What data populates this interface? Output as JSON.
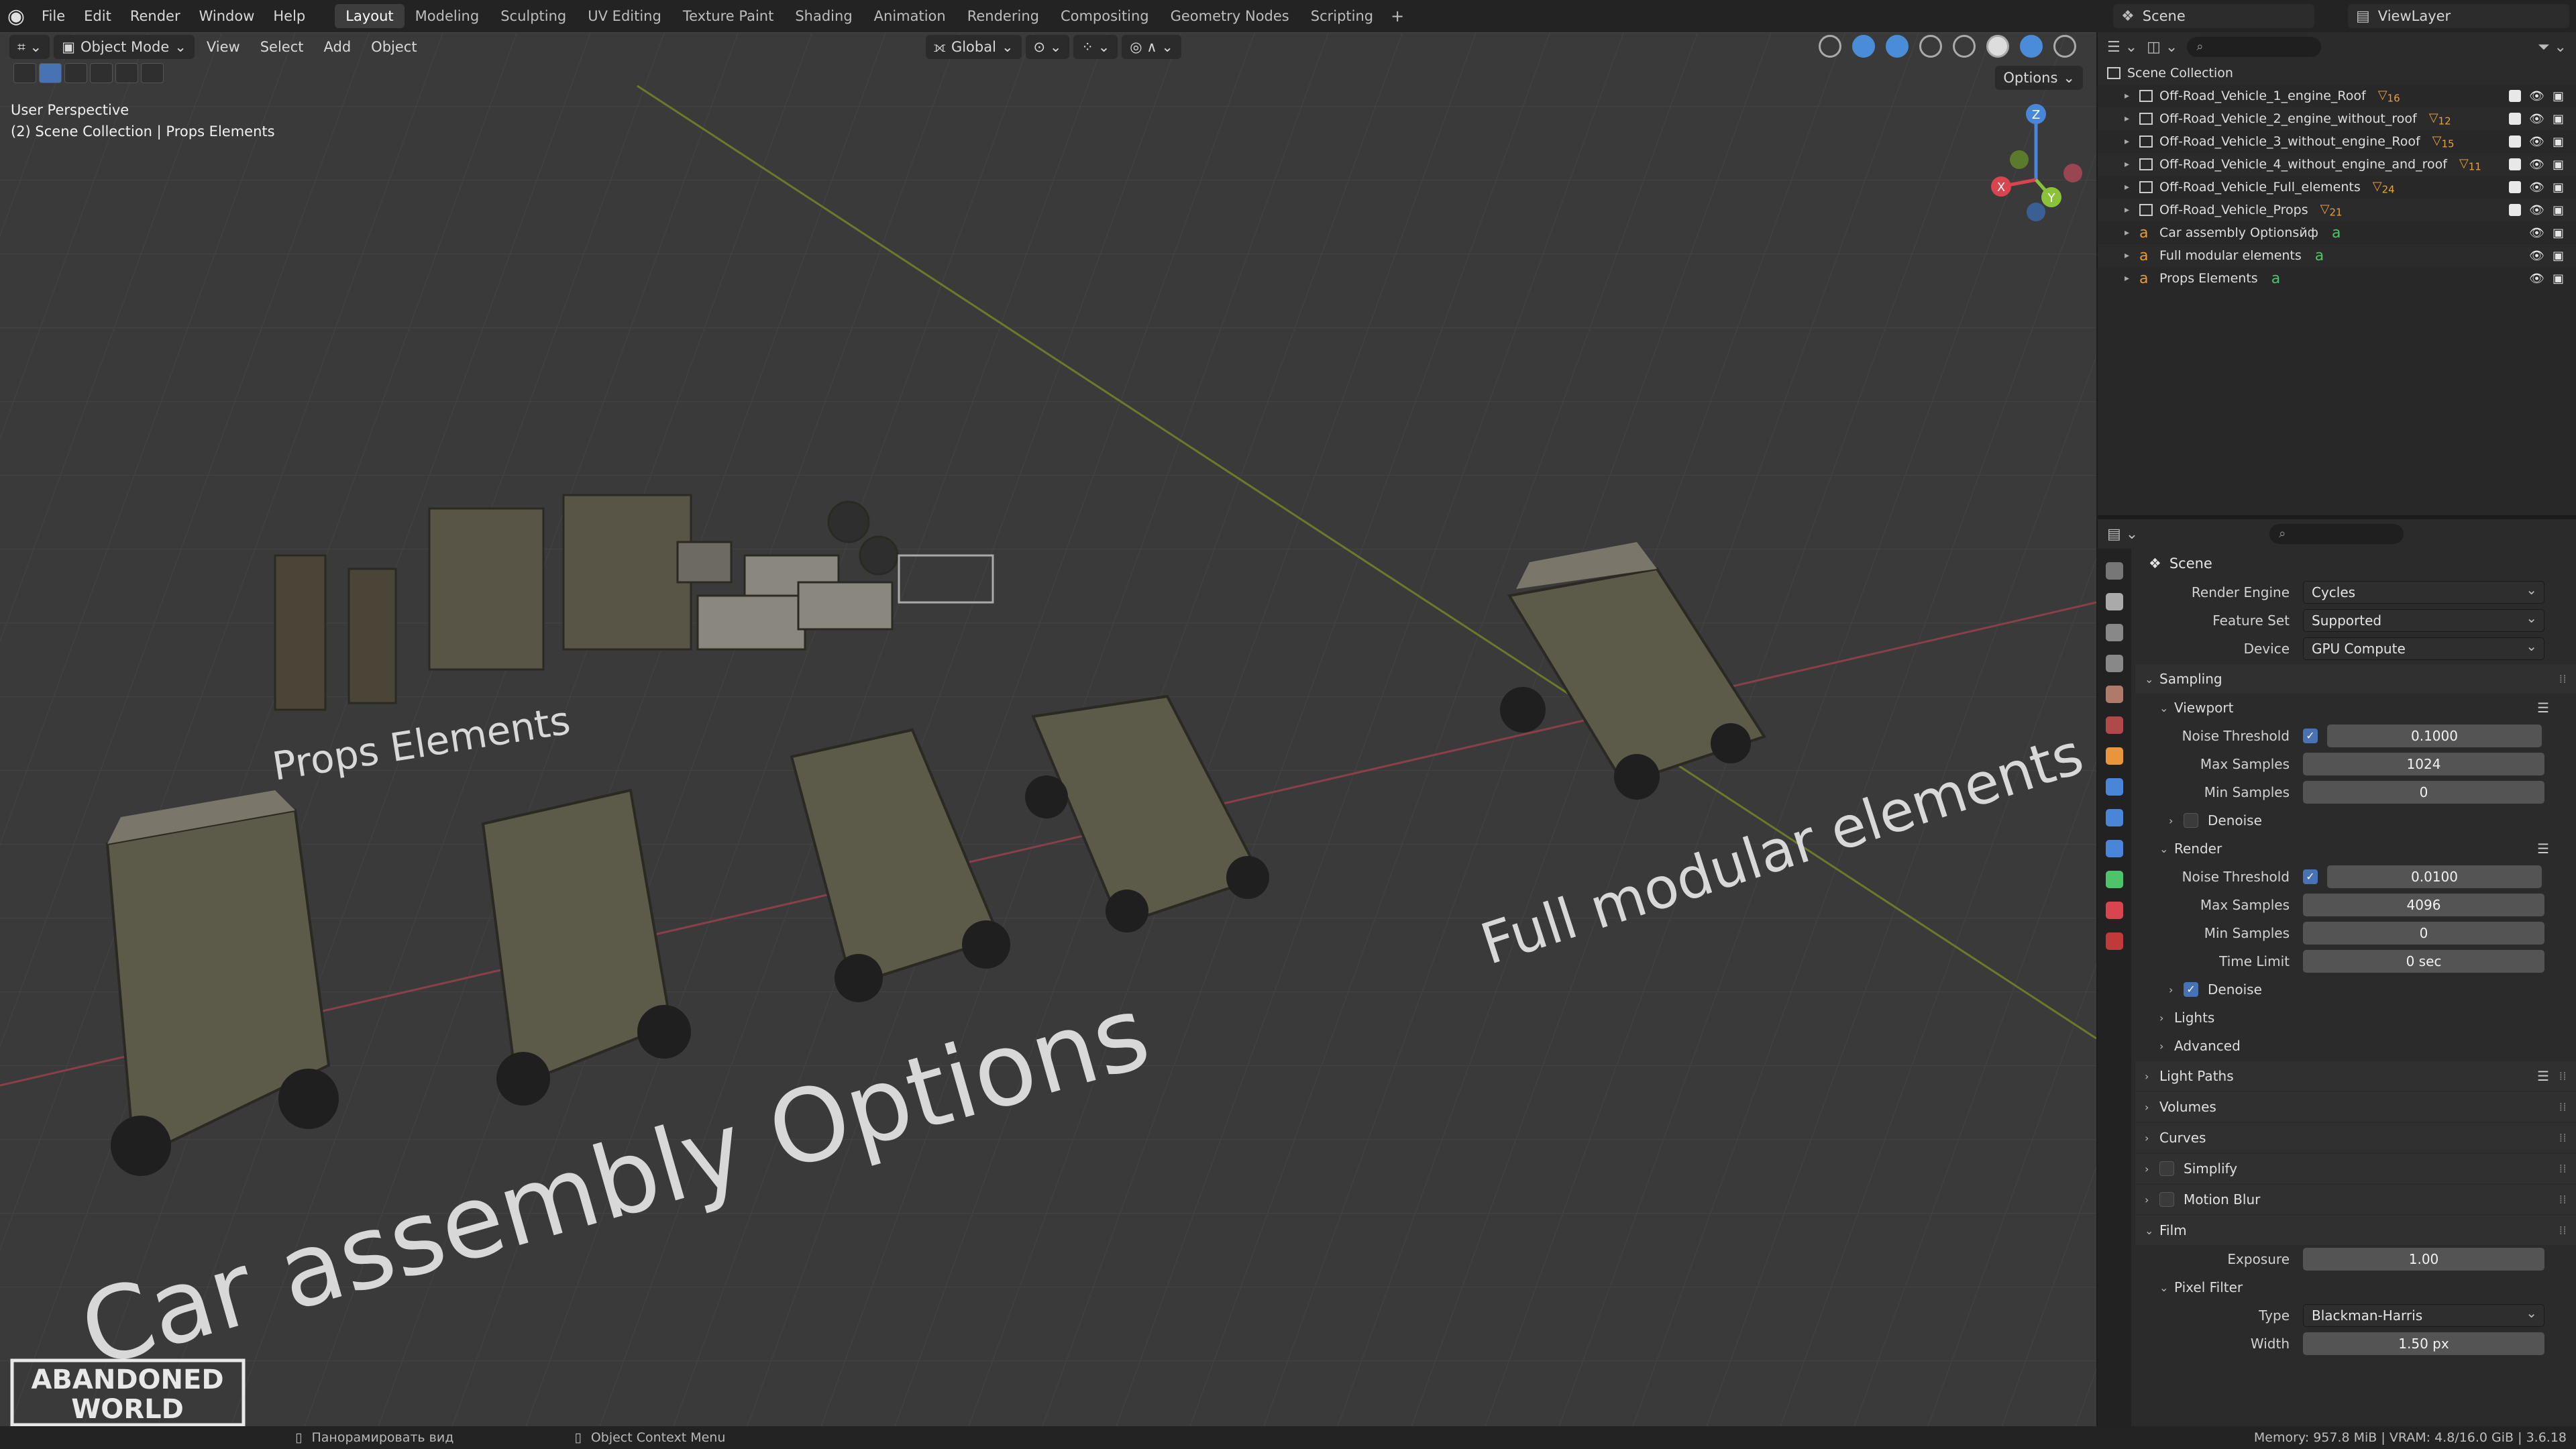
{
  "topbar": {
    "menus": [
      "File",
      "Edit",
      "Render",
      "Window",
      "Help"
    ],
    "workspaces": [
      "Layout",
      "Modeling",
      "Sculpting",
      "UV Editing",
      "Texture Paint",
      "Shading",
      "Animation",
      "Rendering",
      "Compositing",
      "Geometry Nodes",
      "Scripting"
    ],
    "active_workspace": "Layout",
    "scene": "Scene",
    "view_layer": "ViewLayer"
  },
  "viewport": {
    "mode": "Object Mode",
    "menus": [
      "View",
      "Select",
      "Add",
      "Object"
    ],
    "transform": "Global",
    "options": "Options",
    "info_line1": "User Perspective",
    "info_line2": "(2) Scene Collection | Props Elements",
    "label_props": "Props Elements",
    "label_car": "Car assembly Options",
    "label_full": "Full modular elements",
    "gizmo": {
      "x": "X",
      "y": "Y",
      "z": "Z"
    },
    "watermark_line1": "ABANDONED",
    "watermark_line2": "WORLD"
  },
  "outliner": {
    "root": "Scene Collection",
    "rows": [
      {
        "name": "Off-Road_Vehicle_1_engine_Roof",
        "badge": "16"
      },
      {
        "name": "Off-Road_Vehicle_2_engine_without_roof",
        "badge": "12"
      },
      {
        "name": "Off-Road_Vehicle_3_without_engine_Roof",
        "badge": "15"
      },
      {
        "name": "Off-Road_Vehicle_4_without_engine_and_roof",
        "badge": "11"
      },
      {
        "name": "Off-Road_Vehicle_Full_elements",
        "badge": "24"
      },
      {
        "name": "Off-Road_Vehicle_Props",
        "badge": "21"
      }
    ],
    "text_objects": [
      "Car assembly Optionsйф",
      "Full modular elements",
      "Props Elements"
    ]
  },
  "properties": {
    "title": "Scene",
    "render_engine_label": "Render Engine",
    "render_engine": "Cycles",
    "feature_set_label": "Feature Set",
    "feature_set": "Supported",
    "device_label": "Device",
    "device": "GPU Compute",
    "sampling": "Sampling",
    "viewport": "Viewport",
    "noise_threshold_label": "Noise Threshold",
    "vp_noise_threshold": "0.1000",
    "max_samples_label": "Max Samples",
    "vp_max_samples": "1024",
    "min_samples_label": "Min Samples",
    "vp_min_samples": "0",
    "denoise": "Denoise",
    "render": "Render",
    "r_noise_threshold": "0.0100",
    "r_max_samples": "4096",
    "r_min_samples": "0",
    "time_limit_label": "Time Limit",
    "time_limit": "0 sec",
    "lights": "Lights",
    "advanced": "Advanced",
    "light_paths": "Light Paths",
    "volumes": "Volumes",
    "curves": "Curves",
    "simplify": "Simplify",
    "motion_blur": "Motion Blur",
    "film": "Film",
    "exposure_label": "Exposure",
    "exposure": "1.00",
    "pixel_filter": "Pixel Filter",
    "type_label": "Type",
    "filter_type": "Blackman-Harris",
    "width_label": "Width",
    "filter_width": "1.50 px"
  },
  "statusbar": {
    "pan": "Панорамировать вид",
    "context": "Object Context Menu",
    "memory": "Memory: 957.8 MiB | VRAM: 4.8/16.0 GiB | 3.6.18"
  }
}
